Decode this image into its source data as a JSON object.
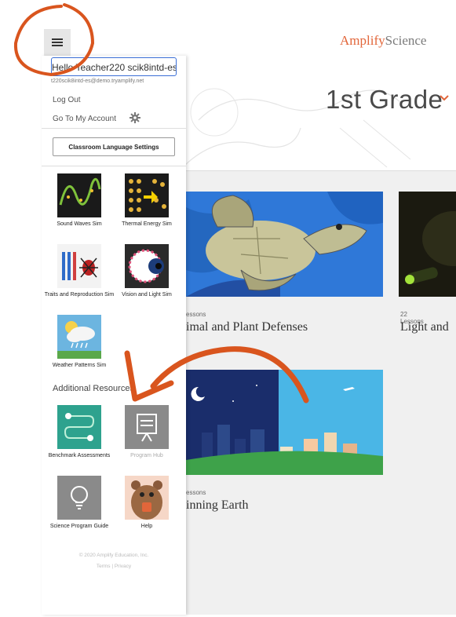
{
  "header": {
    "logo_part1": "Amplify",
    "logo_part2": "Science",
    "grade": "1st Grade"
  },
  "units": [
    {
      "lessons": "essons",
      "title": "imal and Plant Defenses"
    },
    {
      "lessons": "22 Lessons",
      "title": "Light and"
    },
    {
      "lessons": "essons",
      "title": "inning Earth"
    }
  ],
  "drawer": {
    "user_name": "Hello Teacher220 scik8intd-es",
    "user_email": "t220scik8intd-es@demo.tryamplify.net",
    "logout": "Log Out",
    "account": "Go To My Account",
    "lang_button": "Classroom Language Settings",
    "sims": [
      {
        "label": "Sound Waves Sim",
        "icon": "sound-waves-icon"
      },
      {
        "label": "Thermal Energy Sim",
        "icon": "thermal-energy-icon"
      },
      {
        "label": "Traits and Reproduction Sim",
        "icon": "traits-icon"
      },
      {
        "label": "Vision and Light Sim",
        "icon": "vision-icon"
      },
      {
        "label": "Weather Patterns Sim",
        "icon": "weather-icon"
      }
    ],
    "additional_heading": "Additional Resources",
    "resources": [
      {
        "label": "Benchmark Assessments",
        "icon": "benchmark-icon"
      },
      {
        "label": "Program Hub",
        "icon": "program-hub-icon"
      },
      {
        "label": "Science Program Guide",
        "icon": "lightbulb-icon"
      },
      {
        "label": "Help",
        "icon": "bear-icon"
      }
    ],
    "copyright": "© 2020 Amplify Education, Inc.",
    "legal": "Terms | Privacy"
  },
  "colors": {
    "accent": "#e2663a",
    "focus": "#3b6fd6"
  }
}
